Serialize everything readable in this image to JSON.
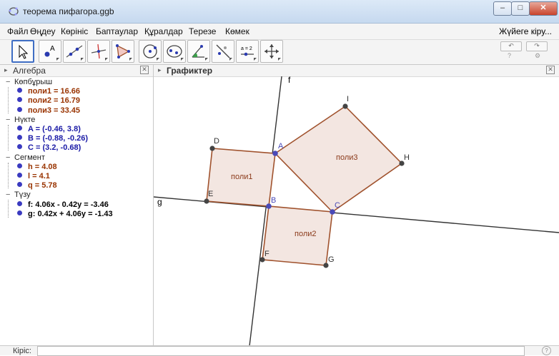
{
  "window": {
    "title": "теорема пифагора.ggb"
  },
  "menu": [
    "Файл",
    "Өңдеу",
    "Көрініс",
    "Баптаулар",
    "Құралдар",
    "Терезе",
    "Көмек"
  ],
  "menu_right": "Жүйеге кіру...",
  "toolbar": {
    "tools": [
      "move-tool",
      "point-tool",
      "line-tool",
      "perpendicular-tool",
      "polygon-tool",
      "circle-tool",
      "conic-tool",
      "angle-tool",
      "reflect-tool",
      "slider-tool",
      "move-view-tool"
    ],
    "slider_label": "a = 2"
  },
  "algebra": {
    "title": "Алгебра",
    "groups": [
      {
        "name": "Көпбұрыш",
        "items": [
          {
            "text": "поли1 = 16.66",
            "color": "#993300"
          },
          {
            "text": "поли2 = 16.79",
            "color": "#993300"
          },
          {
            "text": "поли3 = 33.45",
            "color": "#993300"
          }
        ]
      },
      {
        "name": "Нүкте",
        "items": [
          {
            "text": "A = (-0.46, 3.8)",
            "color": "#1a1aa6"
          },
          {
            "text": "B = (-0.88, -0.26)",
            "color": "#1a1aa6"
          },
          {
            "text": "C = (3.2, -0.68)",
            "color": "#1a1aa6"
          }
        ]
      },
      {
        "name": "Сегмент",
        "items": [
          {
            "text": "h = 4.08",
            "color": "#993300"
          },
          {
            "text": "l = 4.1",
            "color": "#993300"
          },
          {
            "text": "q = 5.78",
            "color": "#993300"
          }
        ]
      },
      {
        "name": "Түзу",
        "items": [
          {
            "text": "f: 4.06x - 0.42y = -3.46",
            "color": "#000000"
          },
          {
            "text": "g: 0.42x + 4.06y = -1.43",
            "color": "#000000"
          }
        ]
      }
    ]
  },
  "graphics": {
    "title": "Графиктер",
    "labels": {
      "f": "f",
      "g": "g",
      "A": "A",
      "B": "B",
      "C": "C",
      "D": "D",
      "E": "E",
      "F": "F",
      "G": "G",
      "H": "H",
      "I": "I",
      "poly1": "поли1",
      "poly2": "поли2",
      "poly3": "поли3"
    },
    "colors": {
      "polygon_fill": "#f3e6e1",
      "polygon_stroke": "#a0522d",
      "line": "#333333",
      "point_free": "#4a4ab8",
      "point_dep": "#444444"
    }
  },
  "inputbar": {
    "label": "Кіріс:",
    "value": ""
  }
}
